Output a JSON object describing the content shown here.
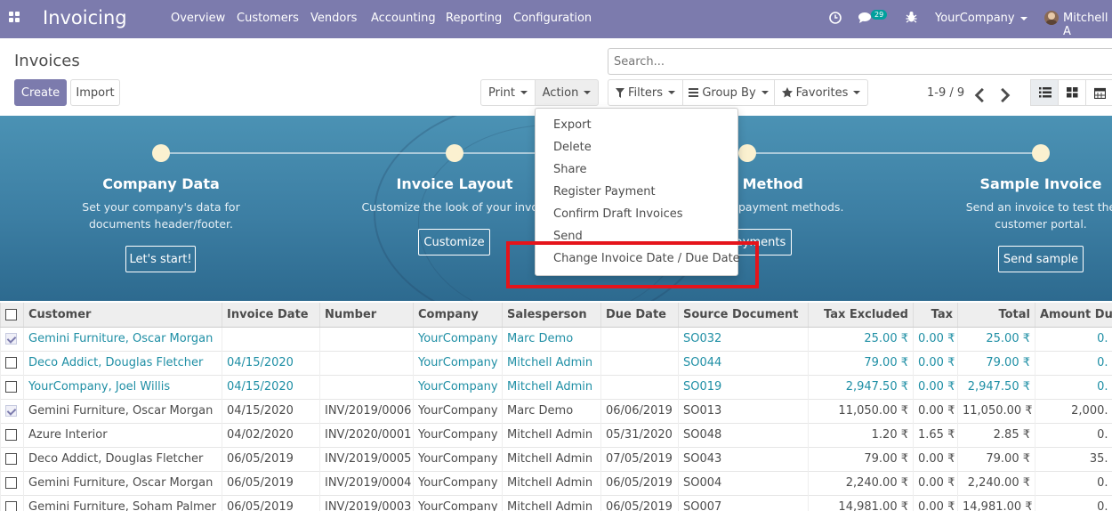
{
  "app": {
    "brand": "Invoicing",
    "menu": [
      "Overview",
      "Customers",
      "Vendors",
      "Accounting",
      "Reporting",
      "Configuration"
    ],
    "message_count": "29",
    "company": "YourCompany",
    "user": "Mitchell A",
    "icons": {
      "apps": "apps-grid-icon",
      "activity": "clock-icon",
      "messages": "chat-icon",
      "debug": "bug-icon",
      "avatar": "user-avatar"
    }
  },
  "control_panel": {
    "title": "Invoices",
    "create_label": "Create",
    "import_label": "Import",
    "print_label": "Print",
    "action_label": "Action",
    "search_placeholder": "Search...",
    "filters_label": "Filters",
    "group_by_label": "Group By",
    "favorites_label": "Favorites",
    "pager": "1-9 / 9",
    "views": [
      "list",
      "kanban",
      "calendar"
    ],
    "active_view": "list"
  },
  "action_menu": {
    "items": [
      "Export",
      "Delete",
      "Share",
      "Register Payment",
      "Confirm Draft Invoices",
      "Send",
      "Change Invoice Date / Due Date"
    ],
    "highlighted_item": "Change Invoice Date / Due Date",
    "highlight_color": "#e5141b"
  },
  "banner": {
    "steps": [
      {
        "title": "Company Data",
        "desc": "Set your company's data for documents header/footer.",
        "button": "Let's start!"
      },
      {
        "title": "Invoice Layout",
        "desc": "Customize the look of your invoices.",
        "button": "Customize"
      },
      {
        "title": "nt Method",
        "desc": "payment methods.",
        "button": "ayments"
      },
      {
        "title": "Sample Invoice",
        "desc": "Send an invoice to test the customer portal.",
        "button": "Send sample"
      }
    ]
  },
  "table": {
    "columns": [
      "Customer",
      "Invoice Date",
      "Number",
      "Company",
      "Salesperson",
      "Due Date",
      "Source Document",
      "Tax Excluded",
      "Tax",
      "Total",
      "Amount Du"
    ],
    "rows": [
      {
        "checked": true,
        "draft": true,
        "cells": [
          "Gemini Furniture, Oscar Morgan",
          "",
          "",
          "YourCompany",
          "Marc Demo",
          "",
          "SO032",
          "25.00 ₹",
          "0.00 ₹",
          "25.00 ₹",
          "0."
        ]
      },
      {
        "checked": false,
        "draft": true,
        "cells": [
          "Deco Addict, Douglas Fletcher",
          "04/15/2020",
          "",
          "YourCompany",
          "Mitchell Admin",
          "",
          "SO044",
          "79.00 ₹",
          "0.00 ₹",
          "79.00 ₹",
          "0."
        ]
      },
      {
        "checked": false,
        "draft": true,
        "cells": [
          "YourCompany, Joel Willis",
          "04/15/2020",
          "",
          "YourCompany",
          "Mitchell Admin",
          "",
          "SO019",
          "2,947.50 ₹",
          "0.00 ₹",
          "2,947.50 ₹",
          "0."
        ]
      },
      {
        "checked": true,
        "draft": false,
        "cells": [
          "Gemini Furniture, Oscar Morgan",
          "04/15/2020",
          "INV/2019/0006",
          "YourCompany",
          "Marc Demo",
          "06/06/2019",
          "SO013",
          "11,050.00 ₹",
          "0.00 ₹",
          "11,050.00 ₹",
          "2,000."
        ]
      },
      {
        "checked": false,
        "draft": false,
        "cells": [
          "Azure Interior",
          "04/02/2020",
          "INV/2020/0001",
          "YourCompany",
          "Mitchell Admin",
          "05/31/2020",
          "SO048",
          "1.20 ₹",
          "1.65 ₹",
          "2.85 ₹",
          "0."
        ]
      },
      {
        "checked": false,
        "draft": false,
        "cells": [
          "Deco Addict, Douglas Fletcher",
          "06/05/2019",
          "INV/2019/0005",
          "YourCompany",
          "Mitchell Admin",
          "07/05/2019",
          "SO043",
          "79.00 ₹",
          "0.00 ₹",
          "79.00 ₹",
          "35."
        ]
      },
      {
        "checked": false,
        "draft": false,
        "cells": [
          "Gemini Furniture, Oscar Morgan",
          "06/05/2019",
          "INV/2019/0004",
          "YourCompany",
          "Mitchell Admin",
          "06/05/2019",
          "SO004",
          "2,240.00 ₹",
          "0.00 ₹",
          "2,240.00 ₹",
          "0."
        ]
      },
      {
        "checked": false,
        "draft": false,
        "cells": [
          "Gemini Furniture, Soham Palmer",
          "06/05/2019",
          "INV/2019/0003",
          "YourCompany",
          "Mitchell Admin",
          "06/05/2019",
          "SO007",
          "14,981.00 ₹",
          "0.00 ₹",
          "14,981.00 ₹",
          "0."
        ]
      }
    ]
  }
}
